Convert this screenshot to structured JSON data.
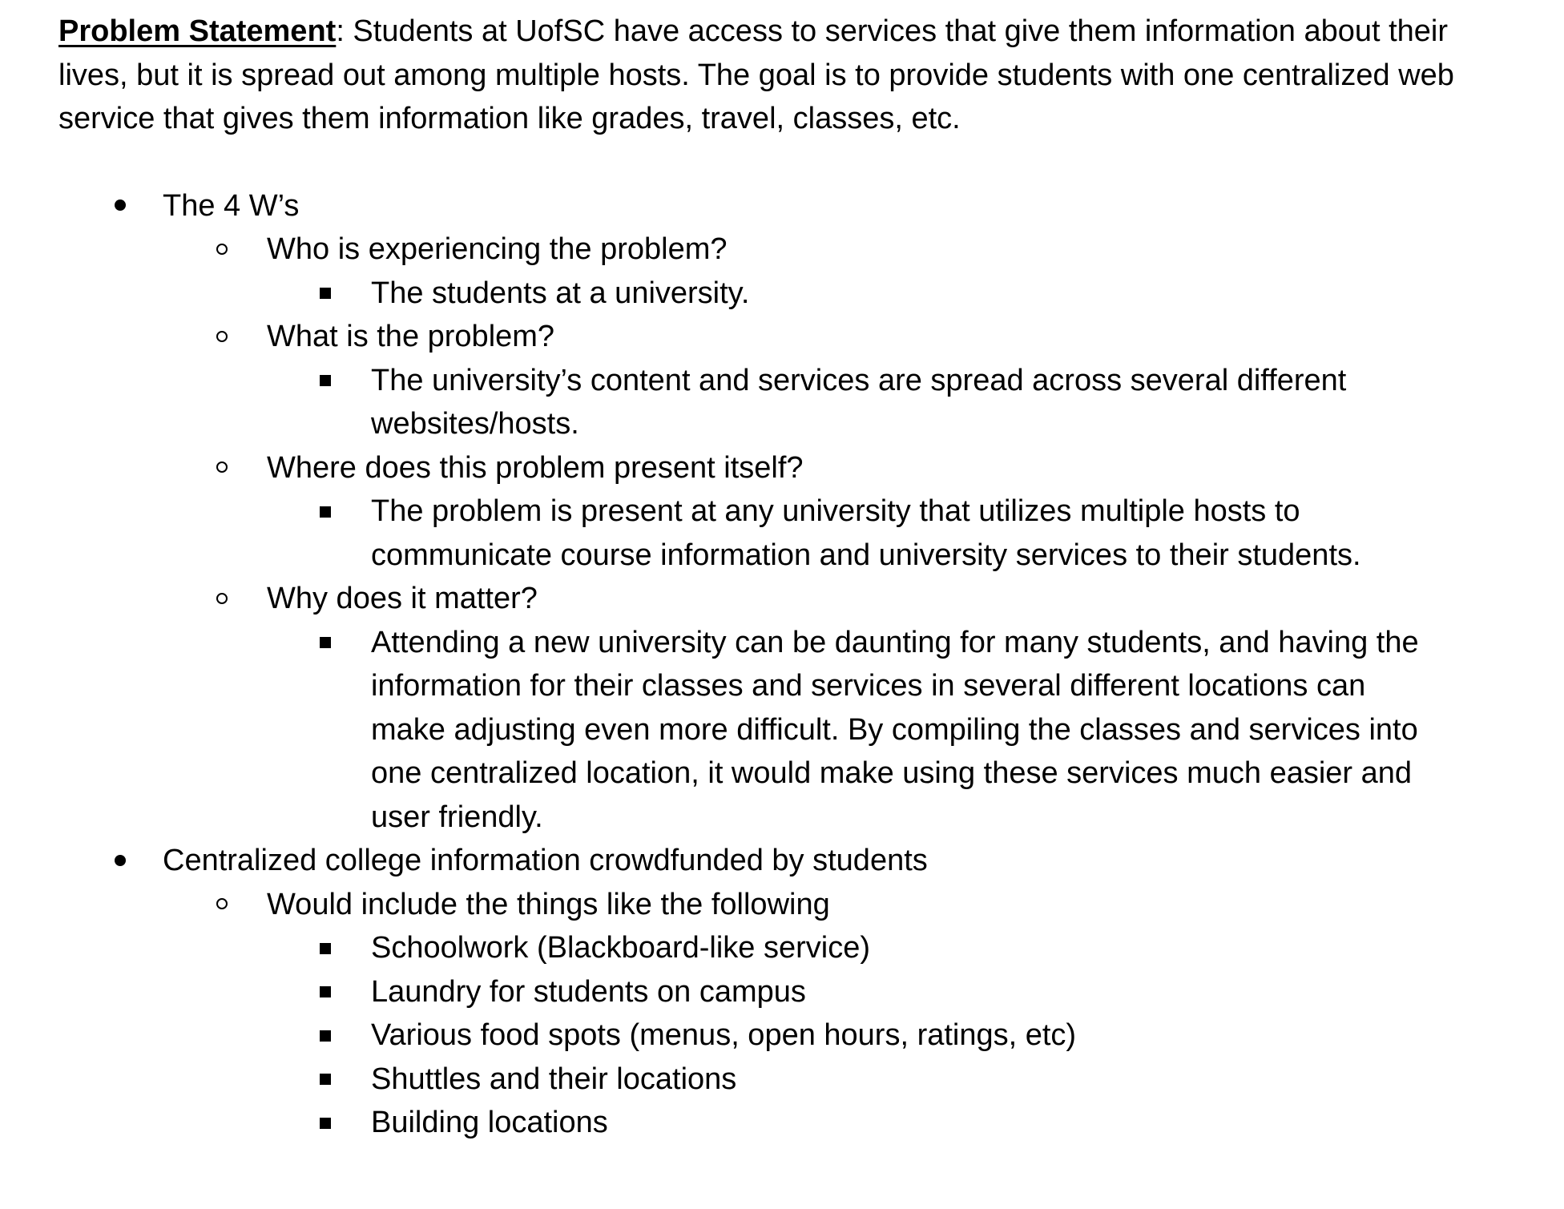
{
  "problem_statement": {
    "label": "Problem Statement",
    "separator": ":",
    "text": " Students at UofSC have access to services that give them information about their lives, but it is spread out among multiple hosts. The goal is to provide students with one centralized web service that gives them information like grades, travel, classes, etc."
  },
  "bullets": [
    {
      "text": "The 4 W’s",
      "sub": [
        {
          "text": "Who is experiencing the problem?",
          "items": [
            "The students at a university."
          ]
        },
        {
          "text": "What is the problem?",
          "items": [
            "The university’s content and services are spread across several different websites/hosts."
          ]
        },
        {
          "text": "Where does this problem present itself?",
          "items": [
            "The problem is present at any university that utilizes multiple hosts to communicate course information and university services to their students."
          ]
        },
        {
          "text": "Why does it matter?",
          "items": [
            "Attending a new university can be daunting for many students, and having the information for their classes and services in several different locations can make adjusting even more difficult. By compiling the classes and services into one centralized location, it would make using these services much easier and user friendly."
          ]
        }
      ]
    },
    {
      "text": "Centralized college information crowdfunded by students",
      "sub": [
        {
          "text": "Would include the things like the following",
          "items": [
            "Schoolwork (Blackboard-like service)",
            "Laundry for students on campus",
            "Various food spots (menus, open hours, ratings, etc)",
            "Shuttles and their locations",
            "Building locations"
          ]
        }
      ]
    }
  ]
}
